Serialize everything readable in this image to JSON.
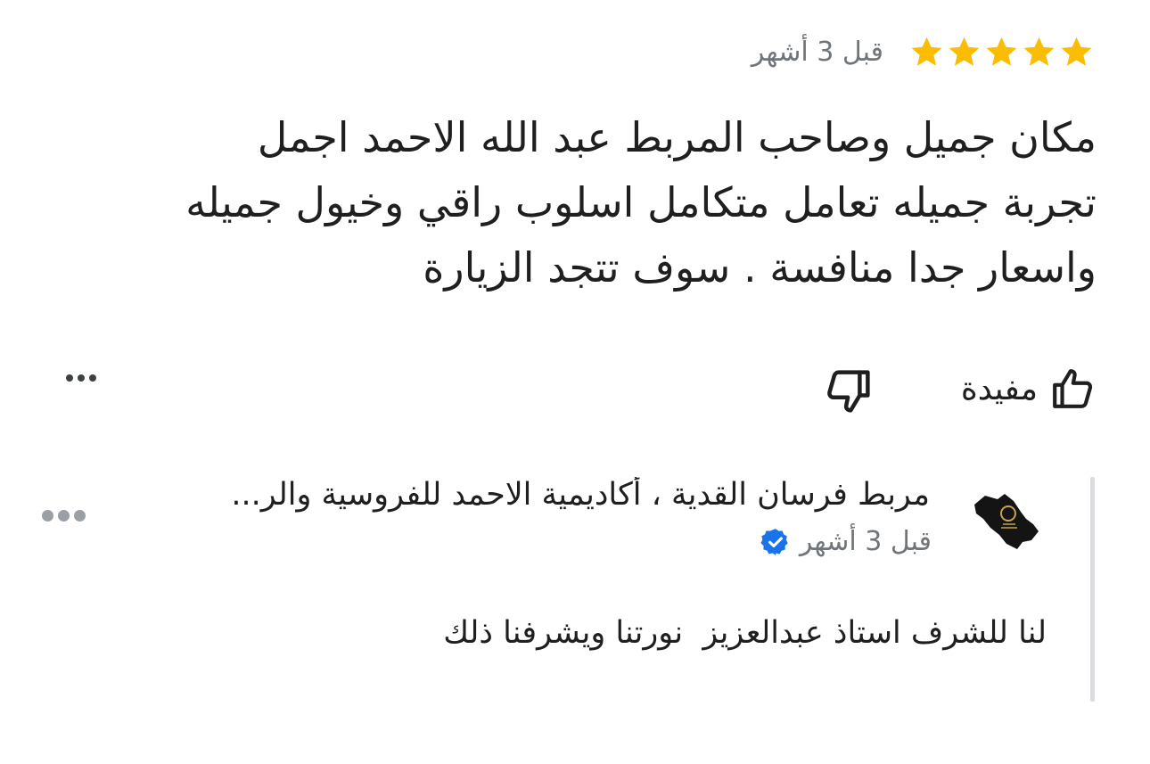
{
  "review": {
    "rating": 5,
    "max_rating": 5,
    "star_color": "#fbbc04",
    "time": "قبل 3 أشهر",
    "text_lines": [
      "مكان جميل وصاحب المربط عبد الله الاحمد اجمل",
      "تجربة جميله تعامل متكامل اسلوب راقي وخيول جميله",
      "واسعار جدا منافسة . سوف تتجد الزيارة"
    ]
  },
  "actions": {
    "helpful_label": "مفيدة",
    "icons": {
      "like": "thumb-up-icon",
      "dislike": "thumb-down-icon",
      "more": "more-horizontal-icon"
    }
  },
  "owner_reply": {
    "name": "مربط فرسان القدية ، أكاديمية الاحمد للفروسية والر...",
    "time": "قبل 3 أشهر",
    "verified_icon": "verified-badge-icon",
    "verified_color": "#1a73e8",
    "avatar_icon": "owner-logo-map-icon",
    "text": "لنا للشرف استاذ عبدالعزيز  نورتنا ويشرفنا ذلك"
  }
}
